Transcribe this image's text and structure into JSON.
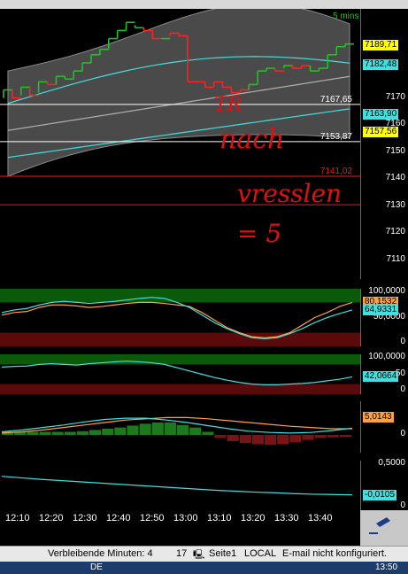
{
  "timeframe": "5 mins",
  "status": {
    "remaining": "Verbleibende Minuten: 4",
    "number": "17",
    "page": "Seite1",
    "local": "LOCAL",
    "email": "E-mail nicht konfiguriert."
  },
  "taskbar": {
    "lang": "DE",
    "clock": "13:50"
  },
  "annotation": {
    "line1": "TR",
    "line2": "nach",
    "line3": "vresslen",
    "line4": "= 5"
  },
  "colors": {
    "up": "#22c022",
    "down": "#ff2020",
    "bands": "#8a8a8a",
    "cyan": "#40e0e0",
    "orange": "#ffa040",
    "panelBorder": "#555555"
  },
  "chart_data": [
    {
      "type": "candlestick",
      "panel": "price",
      "x": [
        "12:10",
        "12:20",
        "12:30",
        "12:40",
        "12:50",
        "13:00",
        "13:10",
        "13:20",
        "13:30",
        "13:40"
      ],
      "yticks": [
        7170,
        7160,
        7150,
        7140,
        7130,
        7120,
        7110
      ],
      "ylim": [
        7103,
        7203
      ],
      "bars": [
        {
          "o": 7170,
          "c": 7173,
          "u": true
        },
        {
          "o": 7173,
          "c": 7170,
          "u": false
        },
        {
          "o": 7171,
          "c": 7174,
          "u": true
        },
        {
          "o": 7174,
          "c": 7171,
          "u": false
        },
        {
          "o": 7172,
          "c": 7176,
          "u": true
        },
        {
          "o": 7176,
          "c": 7175,
          "u": false
        },
        {
          "o": 7175,
          "c": 7178,
          "u": true
        },
        {
          "o": 7178,
          "c": 7177,
          "u": true
        },
        {
          "o": 7177,
          "c": 7180,
          "u": true
        },
        {
          "o": 7180,
          "c": 7183,
          "u": true
        },
        {
          "o": 7183,
          "c": 7186,
          "u": true
        },
        {
          "o": 7186,
          "c": 7188,
          "u": true
        },
        {
          "o": 7188,
          "c": 7192,
          "u": true
        },
        {
          "o": 7192,
          "c": 7195,
          "u": true
        },
        {
          "o": 7195,
          "c": 7198,
          "u": true
        },
        {
          "o": 7197,
          "c": 7196,
          "u": true
        },
        {
          "o": 7196,
          "c": 7195,
          "u": false
        },
        {
          "o": 7195,
          "c": 7192,
          "u": false
        },
        {
          "o": 7192,
          "c": 7192,
          "u": true
        },
        {
          "o": 7193,
          "c": 7194,
          "u": false
        },
        {
          "o": 7194,
          "c": 7193,
          "u": false
        },
        {
          "o": 7193,
          "c": 7176,
          "u": false
        },
        {
          "o": 7176,
          "c": 7176,
          "u": false
        },
        {
          "o": 7176,
          "c": 7174,
          "u": false
        },
        {
          "o": 7174,
          "c": 7176,
          "u": false
        },
        {
          "o": 7176,
          "c": 7174,
          "u": false
        },
        {
          "o": 7174,
          "c": 7172,
          "u": false
        },
        {
          "o": 7172,
          "c": 7173,
          "u": false
        },
        {
          "o": 7173,
          "c": 7175,
          "u": true
        },
        {
          "o": 7175,
          "c": 7180,
          "u": true
        },
        {
          "o": 7180,
          "c": 7181,
          "u": true
        },
        {
          "o": 7181,
          "c": 7180,
          "u": false
        },
        {
          "o": 7181,
          "c": 7182,
          "u": true
        },
        {
          "o": 7182,
          "c": 7181,
          "u": false
        },
        {
          "o": 7181,
          "c": 7182,
          "u": false
        },
        {
          "o": 7182,
          "c": 7180,
          "u": true
        },
        {
          "o": 7180,
          "c": 7181,
          "u": true
        },
        {
          "o": 7181,
          "c": 7186,
          "u": true
        },
        {
          "o": 7186,
          "c": 7189,
          "u": true
        },
        {
          "o": 7189,
          "c": 7190,
          "u": true
        }
      ],
      "levels": [
        {
          "value": "7167,65",
          "color": "#ffffff",
          "y": 7167.65
        },
        {
          "value": "7153,87",
          "color": "#ffffff",
          "y": 7153.87
        },
        {
          "value": "7141,02",
          "color": "#e02020",
          "y": 7141.02
        },
        {
          "value": "",
          "color": "#e02020",
          "y": 7130.5
        }
      ],
      "tags": [
        {
          "value": "7189,71",
          "bg": "#ffff00",
          "fg": "#000000",
          "y": 7189.71
        },
        {
          "value": "7182,48",
          "bg": "#40e0e0",
          "fg": "#000000",
          "y": 7182.48
        },
        {
          "value": "7163,90",
          "bg": "#40e0e0",
          "fg": "#000000",
          "y": 7163.9
        },
        {
          "value": "7157,56",
          "bg": "#ffff00",
          "fg": "#000000",
          "y": 7157.56
        }
      ]
    },
    {
      "type": "line",
      "panel": "osc1",
      "yticks": [
        "100,0000",
        "50,0000",
        "0"
      ],
      "ylim": [
        0,
        100
      ],
      "tags": [
        {
          "value": "80,1532",
          "bg": "#ffa040",
          "fg": "#000000",
          "y": 80.15
        },
        {
          "value": "64,9331",
          "bg": "#40e0e0",
          "fg": "#000000",
          "y": 64.93
        }
      ],
      "series": [
        {
          "color": "#ffa040",
          "values": [
            55,
            60,
            62,
            70,
            75,
            75,
            73,
            70,
            72,
            75,
            78,
            80,
            80,
            78,
            75,
            72,
            60,
            45,
            30,
            20,
            12,
            10,
            12,
            20,
            35,
            50,
            60,
            72,
            80
          ]
        },
        {
          "color": "#40e0e0",
          "values": [
            60,
            65,
            68,
            75,
            80,
            82,
            80,
            78,
            80,
            82,
            85,
            88,
            90,
            88,
            80,
            70,
            55,
            40,
            28,
            18,
            10,
            8,
            10,
            18,
            28,
            40,
            50,
            58,
            65
          ]
        }
      ]
    },
    {
      "type": "line",
      "panel": "osc2",
      "yticks": [
        "100,0000",
        "50",
        "0"
      ],
      "ylim": [
        0,
        100
      ],
      "tags": [
        {
          "value": "42,0664",
          "bg": "#40e0e0",
          "fg": "#000000",
          "y": 42.07
        }
      ],
      "series": [
        {
          "color": "#40e0e0",
          "values": [
            72,
            74,
            75,
            80,
            82,
            80,
            78,
            82,
            85,
            88,
            90,
            88,
            85,
            80,
            70,
            60,
            50,
            40,
            32,
            25,
            20,
            18,
            18,
            20,
            22,
            25,
            30,
            35,
            42
          ]
        }
      ]
    },
    {
      "type": "histogram",
      "panel": "macd",
      "tags": [
        {
          "value": "5,0143",
          "bg": "#ffa040",
          "fg": "#000000",
          "y": 5.01
        }
      ],
      "bars": [
        0.5,
        0.5,
        0.5,
        0.5,
        0.5,
        0.5,
        0.6,
        0.8,
        1.0,
        1.2,
        1.5,
        1.8,
        2.0,
        2.0,
        1.6,
        1.2,
        0.5,
        -0.5,
        -1.0,
        -1.3,
        -1.5,
        -1.6,
        -1.5,
        -1.2,
        -0.8,
        -0.5,
        -0.4,
        -0.3
      ],
      "series": [
        {
          "color": "#ffa040",
          "values": [
            0.3,
            0.5,
            0.8,
            1.2,
            1.6,
            2.0,
            2.4,
            2.6,
            2.8,
            2.8,
            2.6,
            2.3,
            2.0,
            1.7,
            1.4,
            1.2,
            1.0,
            1.0
          ]
        },
        {
          "color": "#40e0e0",
          "values": [
            0.5,
            0.8,
            1.2,
            1.6,
            2.1,
            2.5,
            2.7,
            2.7,
            2.4,
            2.0,
            1.5,
            1.0,
            0.6,
            0.4,
            0.3,
            0.4,
            0.7,
            1.1
          ]
        }
      ]
    },
    {
      "type": "line",
      "panel": "osc4",
      "yticks": [
        "0,5000",
        "0"
      ],
      "ylim": [
        -0.4,
        1.0
      ],
      "tags": [
        {
          "value": "-0,0105",
          "bg": "#40e0e0",
          "fg": "#000000",
          "y": -0.01
        }
      ],
      "series": [
        {
          "color": "#40e0e0",
          "values": [
            0.6,
            0.55,
            0.5,
            0.46,
            0.42,
            0.38,
            0.34,
            0.3,
            0.26,
            0.22,
            0.18,
            0.14,
            0.11,
            0.08,
            0.06,
            0.03,
            0.01,
            0.0,
            -0.01
          ]
        }
      ]
    }
  ]
}
